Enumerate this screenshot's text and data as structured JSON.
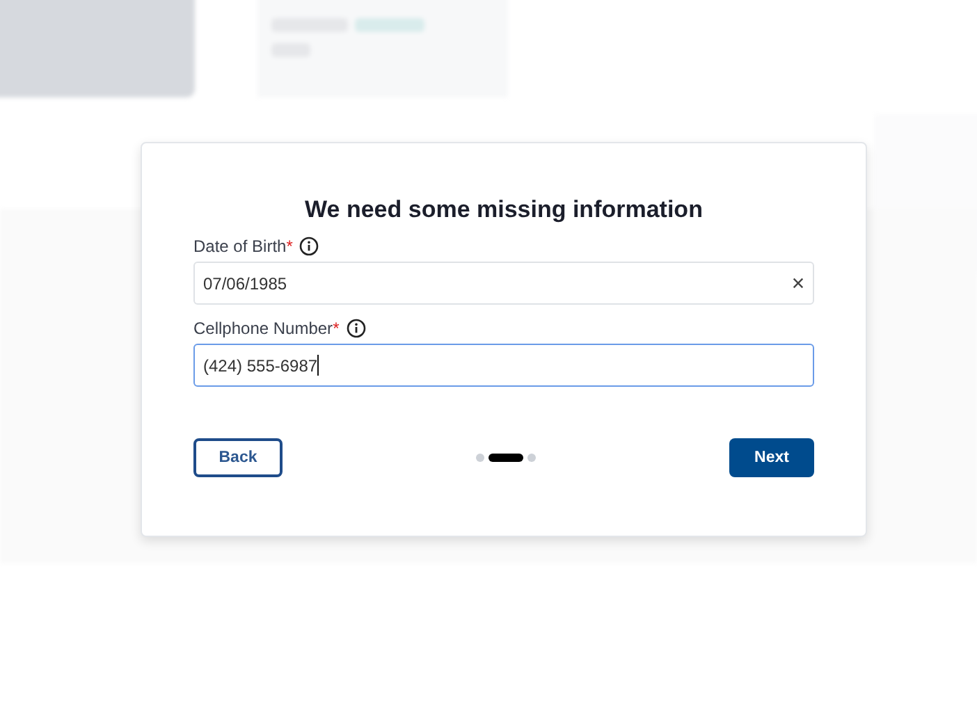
{
  "dialog": {
    "title": "We need some missing information",
    "fields": [
      {
        "label": "Date of Birth",
        "required_mark": "*",
        "value": "07/06/1985",
        "clearable": true,
        "focused": false
      },
      {
        "label": "Cellphone Number",
        "required_mark": "*",
        "value": "(424) 555-6987",
        "clearable": false,
        "focused": true
      }
    ],
    "back_button": "Back",
    "steps": [
      {
        "selected": false
      },
      {
        "selected": true
      },
      {
        "selected": false
      }
    ],
    "next_button": "Next"
  }
}
